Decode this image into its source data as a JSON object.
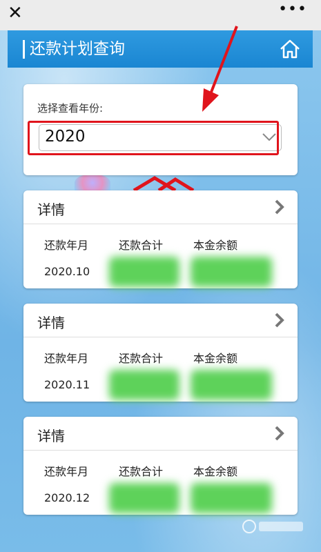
{
  "topbar": {
    "close_icon": "close-icon",
    "more_icon": "more-dots-icon"
  },
  "header": {
    "title": "还款计划查询",
    "home_icon": "home-icon"
  },
  "year_selector": {
    "label": "选择查看年份:",
    "selected_value": "2020"
  },
  "annotation_color": "#e0141c",
  "detail_cards": [
    {
      "title": "详情",
      "columns": [
        "还款年月",
        "还款合计",
        "本金余额"
      ],
      "month": "2020.10"
    },
    {
      "title": "详情",
      "columns": [
        "还款年月",
        "还款合计",
        "本金余额"
      ],
      "month": "2020.11"
    },
    {
      "title": "详情",
      "columns": [
        "还款年月",
        "还款合计",
        "本金余额"
      ],
      "month": "2020.12"
    }
  ]
}
